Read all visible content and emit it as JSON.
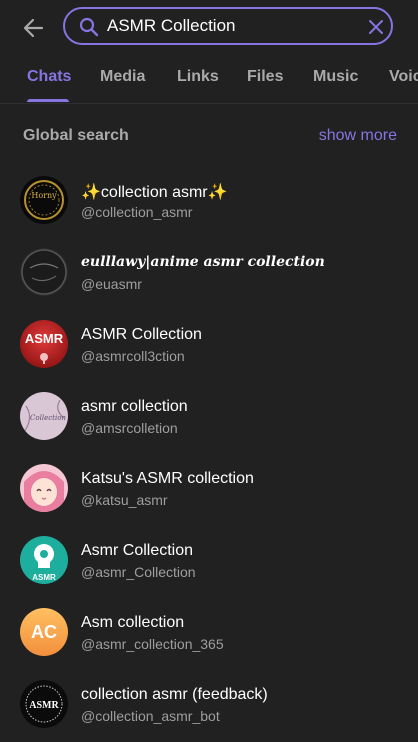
{
  "search": {
    "value": "ASMR Collection",
    "placeholder": "Search"
  },
  "tabs": [
    {
      "label": "Chats"
    },
    {
      "label": "Media"
    },
    {
      "label": "Links"
    },
    {
      "label": "Files"
    },
    {
      "label": "Music"
    },
    {
      "label": "Voice"
    }
  ],
  "section": {
    "title": "Global search",
    "show_more": "show more"
  },
  "results": [
    {
      "name": "✨collection asmr✨",
      "handle": "@collection_asmr",
      "avatar_text": "Horny"
    },
    {
      "name": "eulllawy|anime asmr collection",
      "handle": "@euasmr",
      "avatar_text": ""
    },
    {
      "name": "ASMR Collection",
      "handle": "@asmrcoll3ction",
      "avatar_text": "ASMR"
    },
    {
      "name": "asmr collection",
      "handle": "@amsrcolletion",
      "avatar_text": "Collection"
    },
    {
      "name": "Katsu's ASMR collection",
      "handle": "@katsu_asmr",
      "avatar_text": ""
    },
    {
      "name": "Asmr Collection",
      "handle": "@asmr_Collection",
      "avatar_text": "ASMR"
    },
    {
      "name": "Asm collection",
      "handle": "@asmr_collection_365",
      "avatar_text": "AC"
    },
    {
      "name": "collection asmr (feedback)",
      "handle": "@collection_asmr_bot",
      "avatar_text": "ASMR"
    }
  ],
  "colors": {
    "accent": "#8774e1",
    "background": "#212121",
    "ac_avatar": "#f9a44a"
  }
}
